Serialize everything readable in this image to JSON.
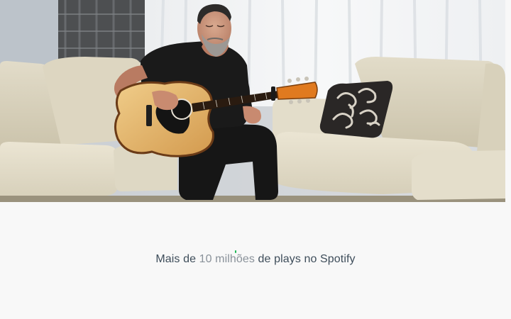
{
  "hero": {
    "image_subject": "musician-playing-acoustic-guitar-on-sofa"
  },
  "stat": {
    "prefix": "Mais de",
    "highlight": "10 milhões",
    "suffix": "de plays no Spotify"
  },
  "colors": {
    "background": "#f8f8f8",
    "text": "#3e4d5a",
    "highlight_text": "#8a929a",
    "spotify_accent": "#1db954"
  }
}
